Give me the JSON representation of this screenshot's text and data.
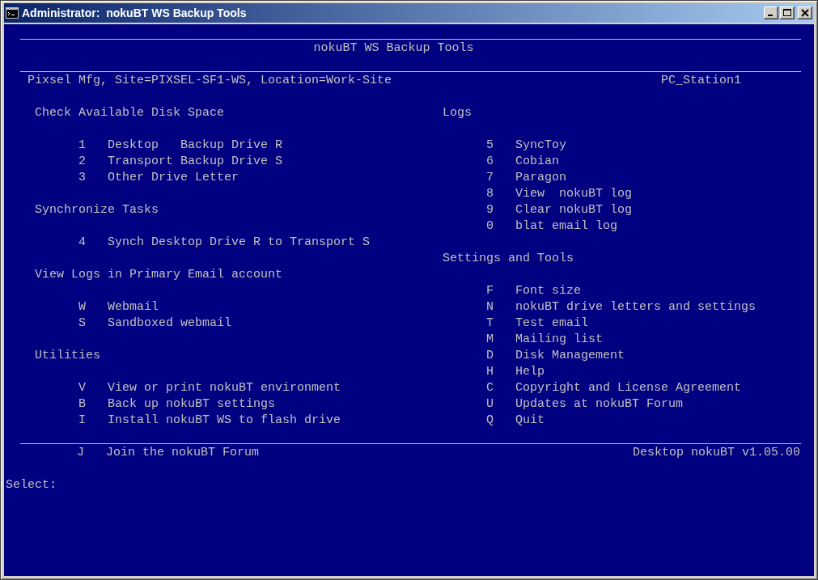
{
  "window": {
    "title": "Administrator:  nokuBT WS Backup Tools"
  },
  "banner": {
    "title": "nokuBT WS Backup Tools"
  },
  "site_line": {
    "location": "Pixsel Mfg, Site=PIXSEL-SF1-WS, Location=Work-Site",
    "station": "PC_Station1"
  },
  "left_sections": [
    {
      "heading": "Check Available Disk Space",
      "items": [
        {
          "key": "1",
          "label": "Desktop   Backup Drive R"
        },
        {
          "key": "2",
          "label": "Transport Backup Drive S"
        },
        {
          "key": "3",
          "label": "Other Drive Letter"
        }
      ]
    },
    {
      "heading": "Synchronize Tasks",
      "items": [
        {
          "key": "4",
          "label": "Synch Desktop Drive R to Transport S"
        }
      ]
    },
    {
      "heading": "View Logs in Primary Email account",
      "items": [
        {
          "key": "W",
          "label": "Webmail"
        },
        {
          "key": "S",
          "label": "Sandboxed webmail"
        }
      ]
    },
    {
      "heading": "Utilities",
      "items": [
        {
          "key": "V",
          "label": "View or print nokuBT environment"
        },
        {
          "key": "B",
          "label": "Back up nokuBT settings"
        },
        {
          "key": "I",
          "label": "Install nokuBT WS to flash drive"
        }
      ]
    }
  ],
  "right_sections": [
    {
      "heading": "Logs",
      "items": [
        {
          "key": "5",
          "label": "SyncToy"
        },
        {
          "key": "6",
          "label": "Cobian"
        },
        {
          "key": "7",
          "label": "Paragon"
        },
        {
          "key": "8",
          "label": "View  nokuBT log"
        },
        {
          "key": "9",
          "label": "Clear nokuBT log"
        },
        {
          "key": "0",
          "label": "blat email log"
        }
      ]
    },
    {
      "heading": "Settings and Tools",
      "items": [
        {
          "key": "F",
          "label": "Font size"
        },
        {
          "key": "N",
          "label": "nokuBT drive letters and settings"
        },
        {
          "key": "T",
          "label": "Test email"
        },
        {
          "key": "M",
          "label": "Mailing list"
        },
        {
          "key": "D",
          "label": "Disk Management"
        },
        {
          "key": "H",
          "label": "Help"
        },
        {
          "key": "C",
          "label": "Copyright and License Agreement"
        },
        {
          "key": "U",
          "label": "Updates at nokuBT Forum"
        },
        {
          "key": "Q",
          "label": "Quit"
        }
      ]
    }
  ],
  "footer": {
    "key": "J",
    "label": "Join the nokuBT Forum",
    "version": "Desktop nokuBT v1.05.00"
  },
  "prompt": "Select:"
}
